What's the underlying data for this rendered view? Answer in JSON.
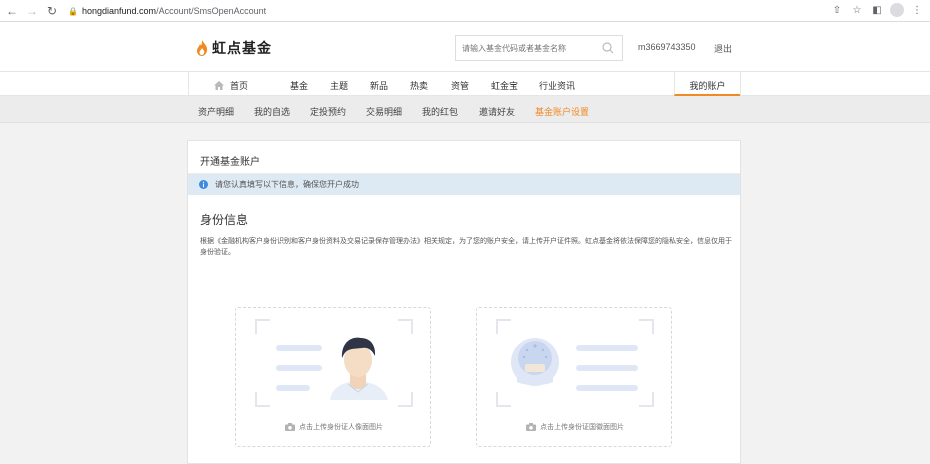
{
  "browser": {
    "url_host": "hongdianfund.com",
    "url_path": "/Account/SmsOpenAccount",
    "back_icon": "arrow-left-icon",
    "forward_icon": "arrow-right-icon",
    "reload_icon": "reload-icon"
  },
  "header": {
    "logo_text": "虹点基金",
    "search_placeholder": "请输入基金代码或者基金名称",
    "username": "m3669743350",
    "logout_label": "退出"
  },
  "main_nav": {
    "items": [
      "首页",
      "基金",
      "主题",
      "新品",
      "热卖",
      "资管",
      "虹金宝",
      "行业资讯"
    ],
    "account_label": "我的账户"
  },
  "sub_nav": {
    "items": [
      "资产明细",
      "我的自选",
      "定投预约",
      "交易明细",
      "我的红包",
      "邀请好友",
      "基金账户设置"
    ],
    "active_index": 6
  },
  "card": {
    "title": "开通基金账户",
    "notice": "请您认真填写以下信息，确保您开户成功",
    "section_title": "身份信息",
    "section_desc": "根据《金融机构客户身份识别和客户身份资料及交易记录保存管理办法》相关规定，为了您的账户安全，请上传开户证件照。虹点基金将依法保障您的隐私安全，信息仅用于身份验证。",
    "upload_front_label": "点击上传身份证人像面图片",
    "upload_back_label": "点击上传身份证国徽面图片"
  },
  "colors": {
    "accent": "#f08a24",
    "notice_bg": "#dde9f3",
    "info_blue": "#3d8be0"
  }
}
